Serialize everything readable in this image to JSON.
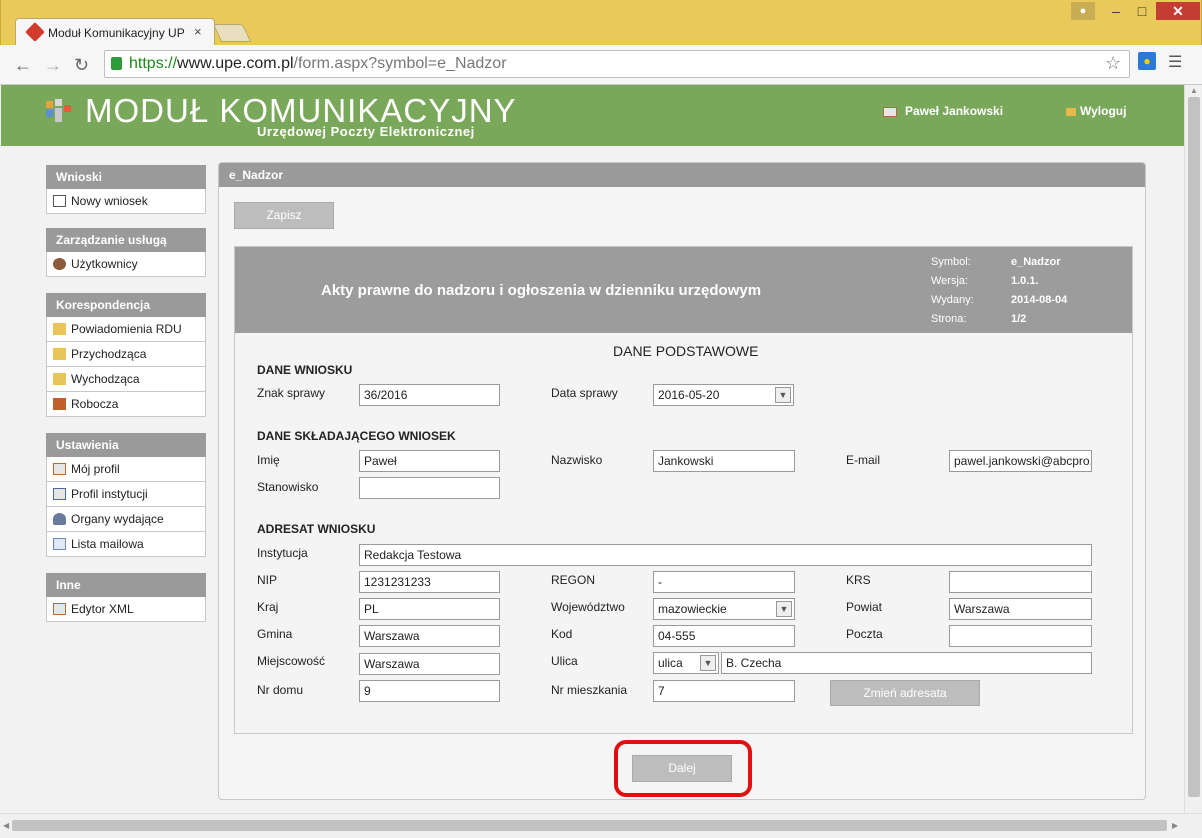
{
  "browser": {
    "tab_title": "Moduł Komunikacyjny UP",
    "tab_close": "×",
    "url_scheme": "https://",
    "url_host": "www.upe.com.pl",
    "url_path": "/form.aspx?symbol=e_Nadzor",
    "win_min": "–",
    "win_max": "□",
    "win_close": "✕"
  },
  "header": {
    "logo_title": "MODUŁ KOMUNIKACYJNY",
    "logo_subtitle": "Urzędowej Poczty Elektronicznej",
    "user_name": "Paweł Jankowski",
    "logout": "Wyloguj",
    "bg_color": "#7aa85a"
  },
  "sidebar": {
    "groups": [
      {
        "title": "Wnioski",
        "items": [
          {
            "label": "Nowy wniosek",
            "icon": "document-icon"
          }
        ]
      },
      {
        "title": "Zarządzanie usługą",
        "items": [
          {
            "label": "Użytkownicy",
            "icon": "users-icon"
          }
        ]
      },
      {
        "title": "Korespondencja",
        "items": [
          {
            "label": "Powiadomienia RDU",
            "icon": "folder-icon"
          },
          {
            "label": "Przychodząca",
            "icon": "folder-in-icon"
          },
          {
            "label": "Wychodząca",
            "icon": "folder-out-icon"
          },
          {
            "label": "Robocza",
            "icon": "book-icon"
          }
        ]
      },
      {
        "title": "Ustawienia",
        "items": [
          {
            "label": "Mój profil",
            "icon": "id-card-icon"
          },
          {
            "label": "Profil instytucji",
            "icon": "id-card-icon"
          },
          {
            "label": "Organy wydające",
            "icon": "person-icon"
          },
          {
            "label": "Lista mailowa",
            "icon": "mail-icon"
          }
        ]
      },
      {
        "title": "Inne",
        "items": [
          {
            "label": "Edytor XML",
            "icon": "id-card-icon"
          }
        ]
      }
    ]
  },
  "main": {
    "panel_title": "e_Nadzor",
    "save_button": "Zapisz",
    "next_button": "Dalej",
    "form_title": "Akty prawne do nadzoru i ogłoszenia w dzienniku urzędowym",
    "meta": {
      "symbol_label": "Symbol:",
      "symbol": "e_Nadzor",
      "version_label": "Wersja:",
      "version": "1.0.1.",
      "issued_label": "Wydany:",
      "issued": "2014-08-04",
      "page_label": "Strona:",
      "page": "1/2"
    },
    "section_main": "DANE PODSTAWOWE",
    "sec_wniosek": "DANE WNIOSKU",
    "sec_skladajacy": "DANE SKŁADAJĄCEGO WNIOSEK",
    "sec_adresat": "ADRESAT WNIOSKU",
    "fields": {
      "znak_label": "Znak sprawy",
      "znak": "36/2016",
      "data_label": "Data sprawy",
      "data": "2016-05-20",
      "imie_label": "Imię",
      "imie": "Paweł",
      "nazwisko_label": "Nazwisko",
      "nazwisko": "Jankowski",
      "email_label": "E-mail",
      "email": "pawel.jankowski@abcpro.",
      "stanowisko_label": "Stanowisko",
      "stanowisko": "",
      "instytucja_label": "Instytucja",
      "instytucja": "Redakcja Testowa",
      "nip_label": "NIP",
      "nip": "1231231233",
      "regon_label": "REGON",
      "regon": "-",
      "krs_label": "KRS",
      "krs": "",
      "kraj_label": "Kraj",
      "kraj": "PL",
      "woj_label": "Województwo",
      "woj": "mazowieckie",
      "powiat_label": "Powiat",
      "powiat": "Warszawa",
      "gmina_label": "Gmina",
      "gmina": "Warszawa",
      "kod_label": "Kod",
      "kod": "04-555",
      "poczta_label": "Poczta",
      "poczta": "",
      "miejscowosc_label": "Miejscowość",
      "miejscowosc": "Warszawa",
      "ulica_label": "Ulica",
      "ulica_type": "ulica",
      "ulica": "B. Czecha",
      "nrdomu_label": "Nr domu",
      "nrdomu": "9",
      "nrmieszk_label": "Nr mieszkania",
      "nrmieszk": "7"
    },
    "change_button": "Zmień adresata"
  }
}
